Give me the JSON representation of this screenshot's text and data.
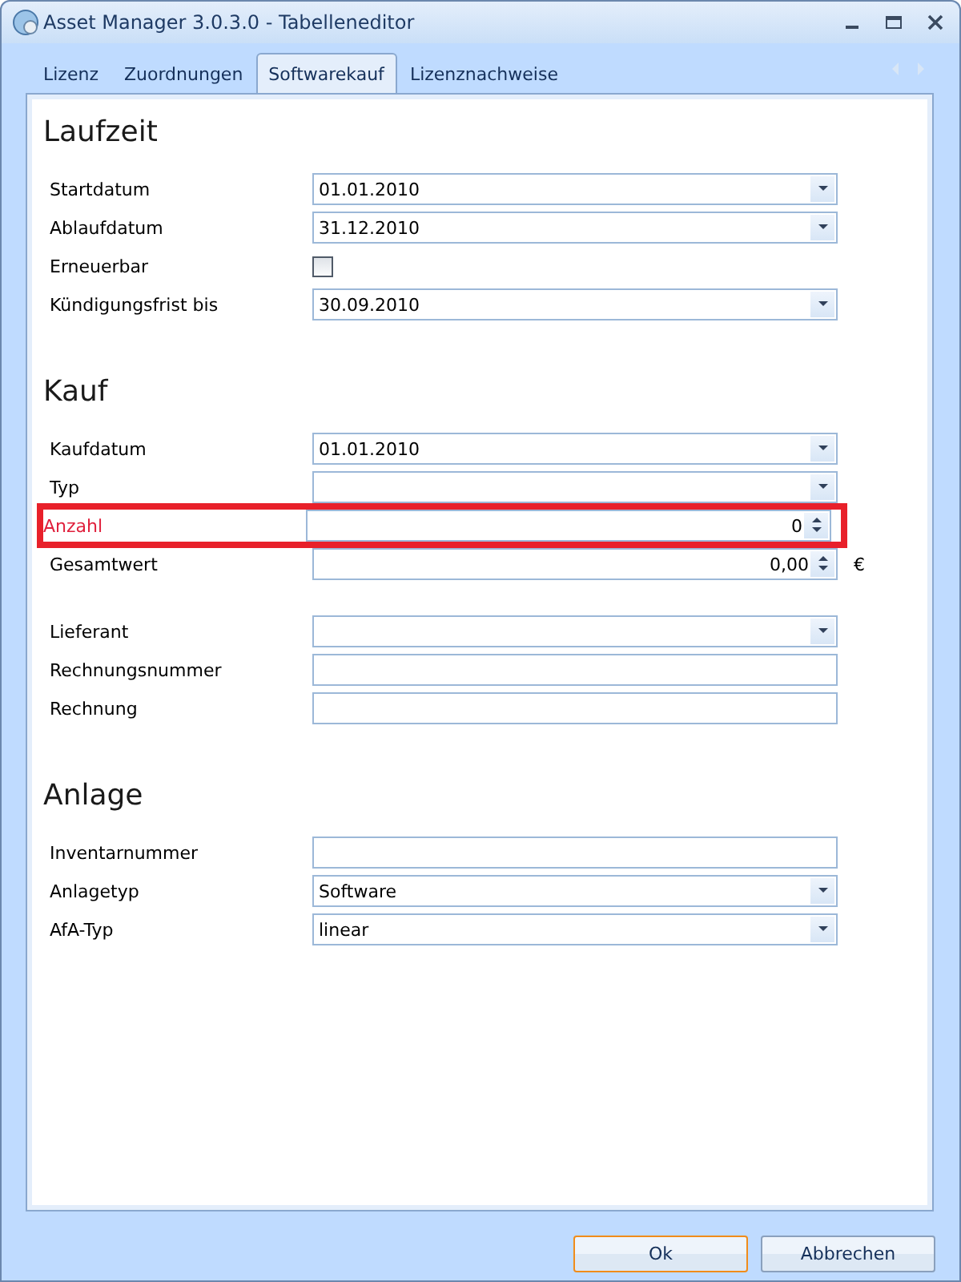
{
  "window": {
    "title": "Asset Manager 3.0.3.0 - Tabelleneditor"
  },
  "tabs": [
    {
      "label": "Lizenz",
      "selected": false
    },
    {
      "label": "Zuordnungen",
      "selected": false
    },
    {
      "label": "Softwarekauf",
      "selected": true
    },
    {
      "label": "Lizenznachweise",
      "selected": false
    }
  ],
  "sections": [
    {
      "title": "Laufzeit",
      "groups": [
        [
          {
            "label": "Startdatum",
            "kind": "dropdown",
            "value": "01.01.2010",
            "highlighted": false
          },
          {
            "label": "Ablaufdatum",
            "kind": "dropdown",
            "value": "31.12.2010",
            "highlighted": false
          },
          {
            "label": "Erneuerbar",
            "kind": "checkbox",
            "checked": false,
            "highlighted": false
          },
          {
            "label": "Kündigungsfrist bis",
            "kind": "dropdown",
            "value": "30.09.2010",
            "highlighted": false
          }
        ]
      ]
    },
    {
      "title": "Kauf",
      "groups": [
        [
          {
            "label": "Kaufdatum",
            "kind": "dropdown",
            "value": "01.01.2010",
            "highlighted": false
          },
          {
            "label": "Typ",
            "kind": "dropdown",
            "highlighted": false
          },
          {
            "label": "Anzahl",
            "kind": "spin",
            "value": "0",
            "highlighted": true
          },
          {
            "label": "Gesamtwert",
            "kind": "spin",
            "value": "0,00",
            "unit": "€",
            "highlighted": false
          }
        ],
        [
          {
            "label": "Lieferant",
            "kind": "dropdown",
            "highlighted": false
          },
          {
            "label": "Rechnungsnummer",
            "kind": "text",
            "highlighted": false
          },
          {
            "label": "Rechnung",
            "kind": "text",
            "highlighted": false
          }
        ]
      ]
    },
    {
      "title": "Anlage",
      "groups": [
        [
          {
            "label": "Inventarnummer",
            "kind": "text",
            "highlighted": false
          },
          {
            "label": "Anlagetyp",
            "kind": "dropdown",
            "value": "Software",
            "highlighted": false
          },
          {
            "label": "AfA-Typ",
            "kind": "dropdown",
            "value": "linear",
            "highlighted": false
          }
        ]
      ]
    }
  ],
  "buttons": [
    {
      "label": "Ok",
      "default": true
    },
    {
      "label": "Abbrechen",
      "default": false
    }
  ]
}
